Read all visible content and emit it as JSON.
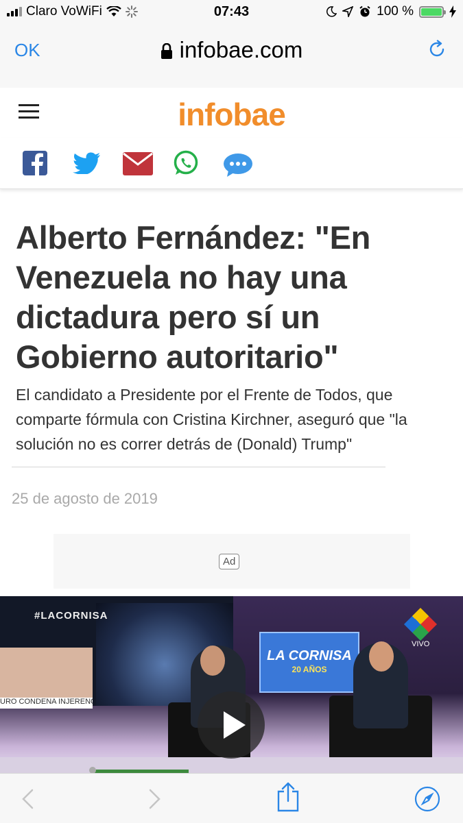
{
  "status_bar": {
    "carrier": "Claro VoWiFi",
    "time": "07:43",
    "battery": "100 %",
    "battery_level": 1.0
  },
  "browser": {
    "done_label": "OK",
    "host": "infobae.com"
  },
  "site": {
    "logo": "infobae"
  },
  "share": {
    "icons": [
      "facebook-icon",
      "twitter-icon",
      "email-icon",
      "whatsapp-icon",
      "sms-icon"
    ],
    "colors": {
      "facebook": "#3b5998",
      "twitter": "#1da1f2",
      "email": "#c0343b",
      "whatsapp": "#25b04a",
      "sms": "#3f99e8"
    }
  },
  "article": {
    "headline": "Alberto Fernández: \"En Venezuela no hay una dictadura pero sí un Gobierno autoritario\"",
    "deck": "El candidato a Presidente por el Frente de Todos, que comparte fórmula con Cristina Kirchner, aseguró que \"la solución no es correr detrás de (Donald) Trump\"",
    "date": "25 de agosto de 2019",
    "ad_label": "Ad"
  },
  "video": {
    "hashtag": "#LACORNISA",
    "screen_title": "LA CORNISA",
    "screen_subtitle": "20 AÑOS",
    "live_label": "VIVO",
    "ticker": "URO CONDENA INJERENCIA"
  },
  "theme": {
    "accent": "#2a86e6",
    "logo_color": "#f18d2b"
  }
}
